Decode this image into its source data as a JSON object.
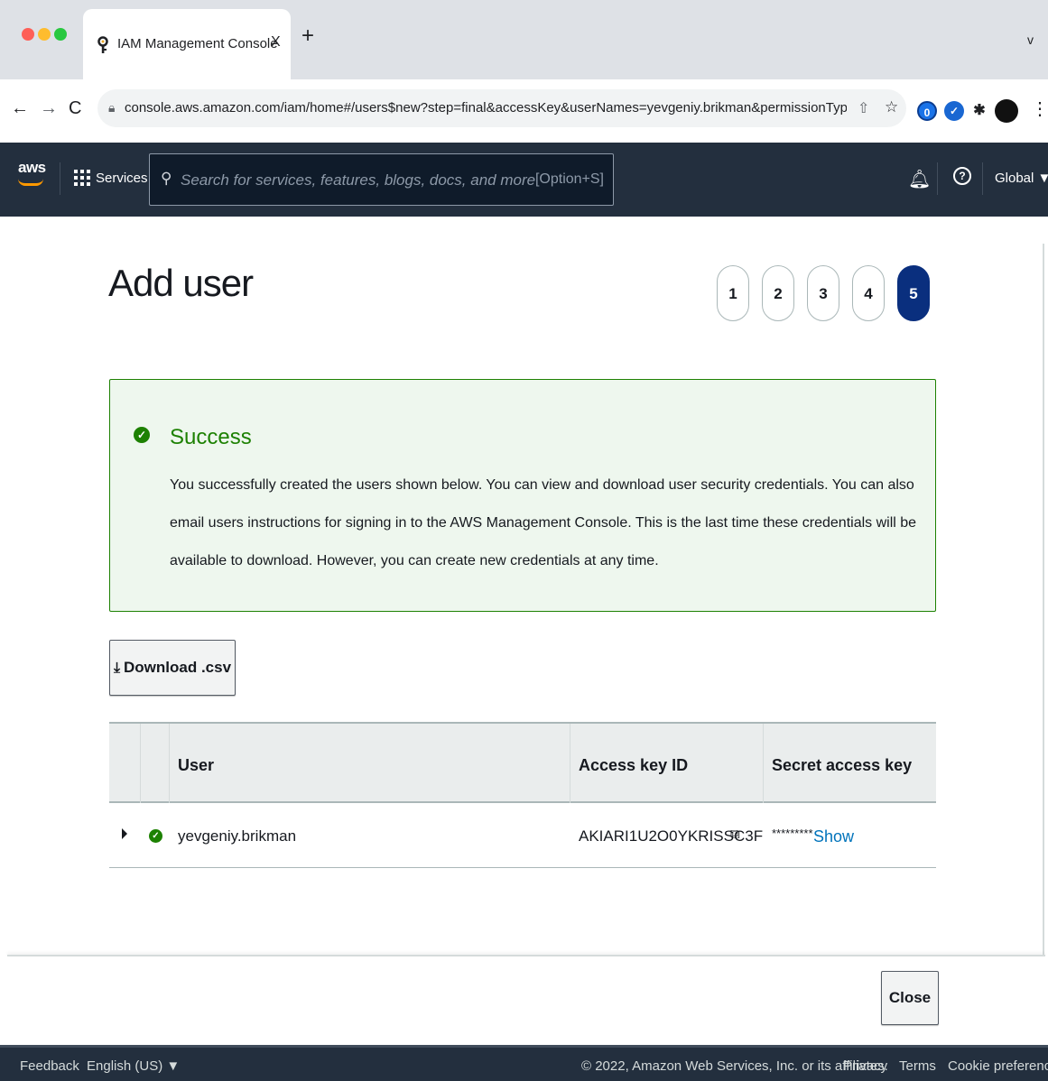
{
  "browser": {
    "tab_title": "IAM Management Console",
    "tab_close": "X",
    "new_tab": "+",
    "tab_menu": "v",
    "url": "console.aws.amazon.com/iam/home#/users$new?step=final&accessKey&userNames=yevgeniy.brikman&permissionType=pol...",
    "extensions": [
      "0",
      "✓"
    ]
  },
  "awsnav": {
    "logo": "aws",
    "services": "Services",
    "search_placeholder": "Search for services, features, blogs, docs, and more",
    "search_shortcut": "[Option+S]",
    "region": "Global ▼"
  },
  "page": {
    "title": "Add user",
    "steps": [
      "1",
      "2",
      "3",
      "4",
      "5"
    ],
    "active_step": "5"
  },
  "alert": {
    "title": "Success",
    "body": "You successfully created the users shown below. You can view and download user security credentials. You can also email users instructions for signing in to the AWS Management Console. This is the last time these credentials will be available to download. However, you can create new credentials at any time."
  },
  "actions": {
    "download": "Download .csv",
    "close": "Close"
  },
  "table": {
    "headers": {
      "user": "User",
      "access_key": "Access key ID",
      "secret": "Secret access key"
    },
    "rows": [
      {
        "user": "yevgeniy.brikman",
        "access_key": "AKIARI1U2O0YKRISSC3F",
        "secret_mask": "*********",
        "show": "Show"
      }
    ]
  },
  "footer": {
    "feedback": "Feedback",
    "language": "English (US) ▼",
    "copyright": "© 2022, Amazon Web Services, Inc. or its affiliates.",
    "privacy": "Privacy",
    "terms": "Terms",
    "cookies": "Cookie preferences"
  },
  "colors": {
    "aws_nav": "#232f3e",
    "success_green": "#1d8102",
    "success_bg": "#eef7ee",
    "link_blue": "#0073bb",
    "active_step": "#0a2f7e"
  }
}
